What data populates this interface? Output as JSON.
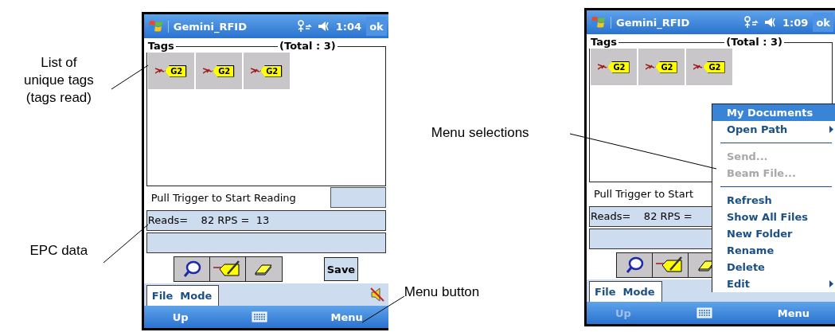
{
  "callouts": [
    {
      "text": "List of unique tags (tags read)"
    },
    {
      "text": "EPC data"
    },
    {
      "text": "Menu selections"
    },
    {
      "text": "Menu button"
    }
  ],
  "phones": [
    {
      "title": "Gemini_RFID",
      "time": "1:04",
      "ok": "ok",
      "tags_heading": "Tags",
      "total": "(Total : 3)",
      "tags": [
        "G2",
        "G2",
        "G2"
      ],
      "prompt": "Pull Trigger to Start Reading",
      "reads": "Reads=    82 RPS =  13",
      "save": "Save",
      "menu_bar": [
        "File",
        "Mode"
      ],
      "muted": true,
      "softkeys": [
        {
          "label": "Up",
          "disabled": false
        },
        {
          "label": "Menu",
          "disabled": false
        }
      ]
    },
    {
      "title": "Gemini_RFID",
      "time": "1:09",
      "ok": "ok",
      "tags_heading": "Tags",
      "total": "(Total : 3)",
      "tags": [
        "G2",
        "G2",
        "G2"
      ],
      "prompt": "Pull Trigger to Start",
      "reads": "Reads=    82 RPS =",
      "menu_bar": [
        "File",
        "Mode"
      ],
      "softkeys": [
        {
          "label": "Up",
          "disabled": true
        },
        {
          "label": "Menu",
          "disabled": false
        }
      ],
      "menu": {
        "items": [
          {
            "kind": "item",
            "label": "My Documents",
            "selected": true,
            "disabled": false,
            "submenu": false
          },
          {
            "kind": "item",
            "label": "Open Path",
            "selected": false,
            "disabled": false,
            "submenu": true
          },
          {
            "kind": "separator"
          },
          {
            "kind": "item",
            "label": "Send...",
            "selected": false,
            "disabled": true,
            "submenu": false
          },
          {
            "kind": "item",
            "label": "Beam File...",
            "selected": false,
            "disabled": true,
            "submenu": false
          },
          {
            "kind": "separator"
          },
          {
            "kind": "item",
            "label": "Refresh",
            "selected": false,
            "disabled": false,
            "submenu": false
          },
          {
            "kind": "item",
            "label": "Show All Files",
            "selected": false,
            "disabled": false,
            "submenu": false
          },
          {
            "kind": "item",
            "label": "New Folder",
            "selected": false,
            "disabled": false,
            "submenu": false
          },
          {
            "kind": "item",
            "label": "Rename",
            "selected": false,
            "disabled": false,
            "submenu": false
          },
          {
            "kind": "item",
            "label": "Delete",
            "selected": false,
            "disabled": false,
            "submenu": false
          },
          {
            "kind": "item",
            "label": "Edit",
            "selected": false,
            "disabled": false,
            "submenu": true
          }
        ]
      }
    }
  ]
}
